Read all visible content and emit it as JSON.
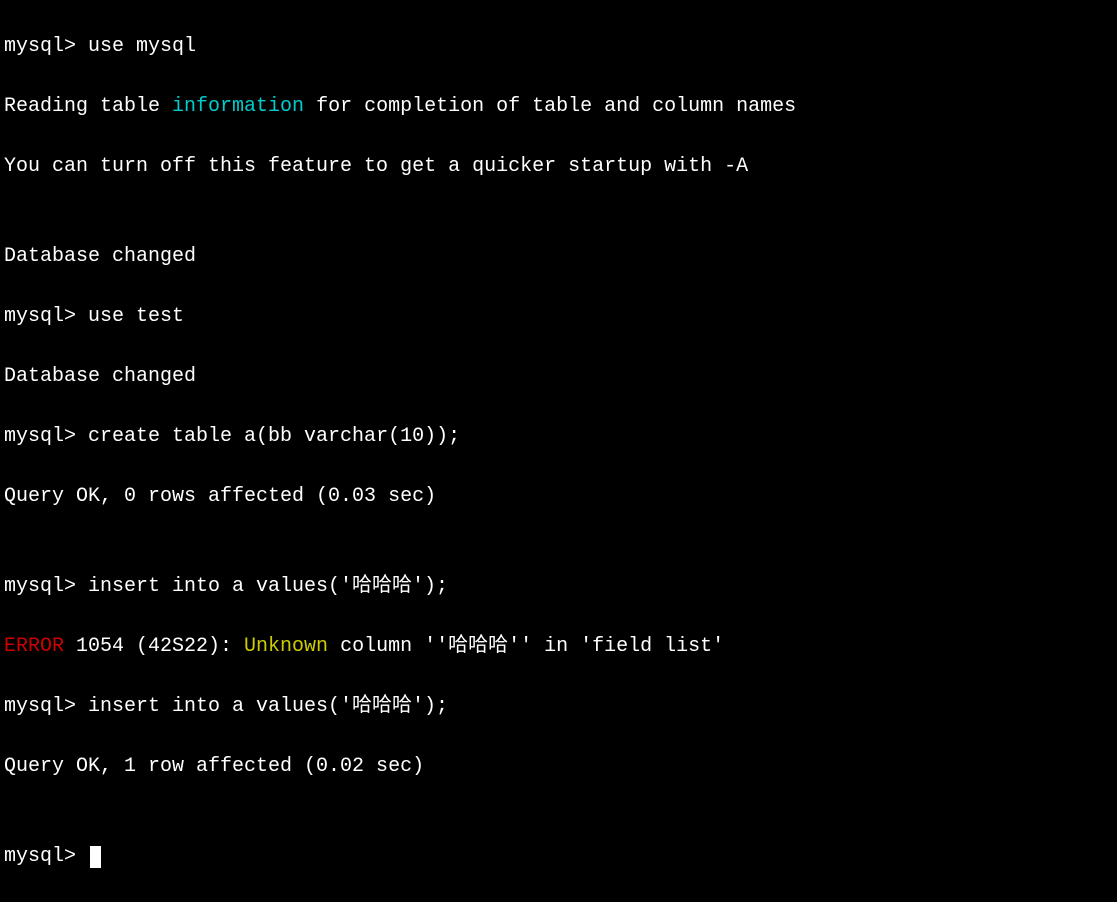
{
  "prompt": "mysql> ",
  "line1_cmd": "use mysql",
  "line2_a": "Reading table ",
  "line2_info": "information",
  "line2_b": " for completion of table and column names",
  "line3": "You can turn off this feature to get a quicker startup with -A",
  "blank": "",
  "line5": "Database changed",
  "line6_cmd": "use test",
  "line7": "Database changed",
  "line8_cmd": "create table a(bb varchar(10));",
  "line9": "Query OK, 0 rows affected (0.03 sec)",
  "line11_cmd": "insert into a values('哈哈哈');",
  "line12_err": "ERROR",
  "line12_a": " 1054 (42S22): ",
  "line12_unk": "Unknown",
  "line12_b": " column ''哈哈哈'' in 'field list'",
  "line13_cmd": "insert into a values('哈哈哈');",
  "line14": "Query OK, 1 row affected (0.02 sec)"
}
